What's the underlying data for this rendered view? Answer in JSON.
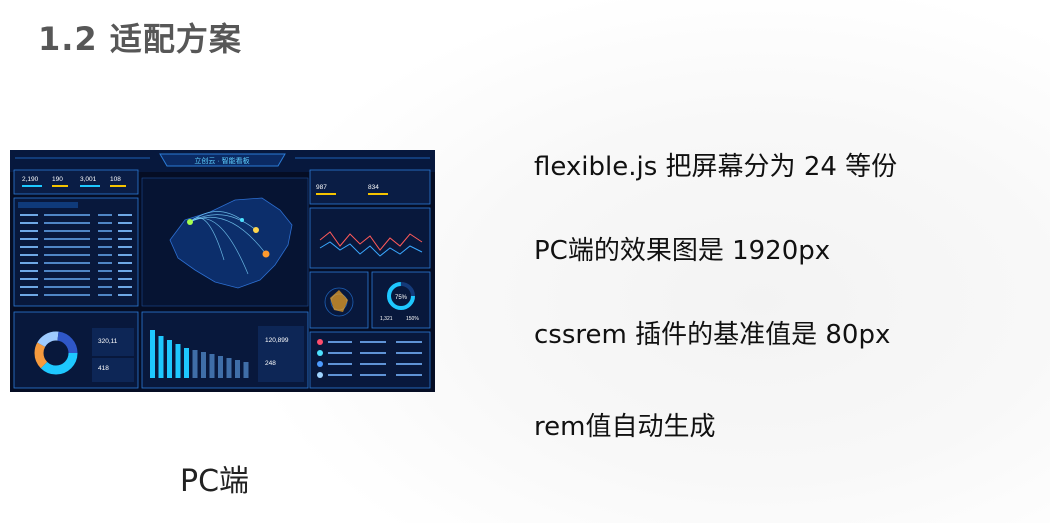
{
  "slide": {
    "title": "1.2 适配方案",
    "caption": "PC端"
  },
  "bullets": [
    "flexible.js 把屏幕分为 24 等份",
    "PC端的效果图是 1920px",
    "cssrem 插件的基准值是  80px",
    "rem值自动生成"
  ],
  "dashboard": {
    "header": "立创云 · 智能看板",
    "stats_top_left": [
      "2,190",
      "190",
      "3,001",
      "108"
    ],
    "stats_top_right": [
      "987",
      "834"
    ],
    "donut_values": [
      "320,11",
      "418"
    ],
    "bar_values": [
      "120,899",
      "248"
    ],
    "gauge_percent": "75%",
    "gauge_values": [
      "1,321",
      "150%"
    ],
    "colors": {
      "background": "#050d24",
      "panel_border": "#2b7bd6",
      "accent_cyan": "#1ec8ff",
      "accent_yellow": "#f5c400"
    }
  }
}
